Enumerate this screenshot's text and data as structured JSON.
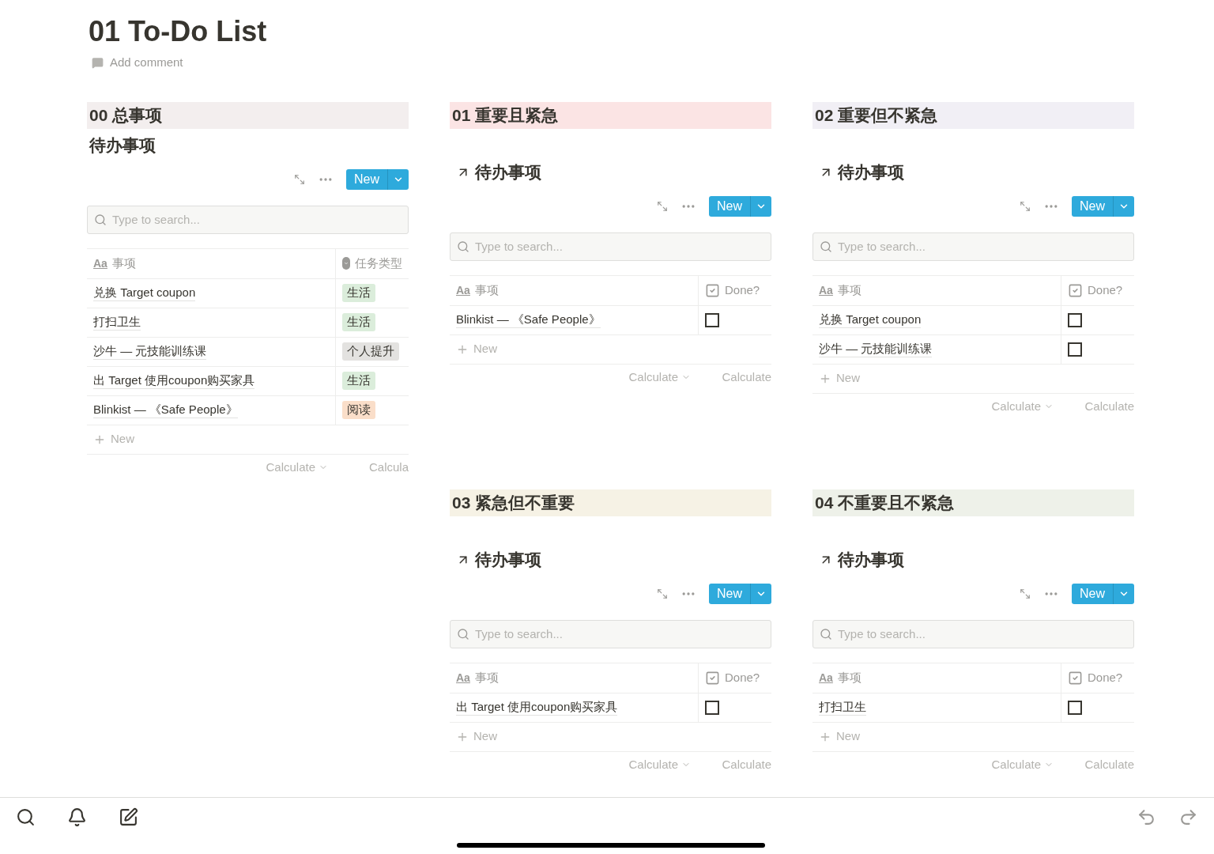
{
  "page": {
    "title": "01 To-Do List",
    "comment_action": "Add comment"
  },
  "sections": [
    {
      "title": "00 总事项",
      "color": "#f3eeee",
      "view": {
        "kind": "inline",
        "title": "待办事项",
        "new_button": "New",
        "search": {
          "placeholder": "Type to search..."
        },
        "columns": [
          {
            "kind": "title",
            "icon_text": "Aa",
            "label": "事项"
          },
          {
            "kind": "select",
            "label": "任务类型"
          }
        ],
        "rows": [
          {
            "title": "兑换 Target coupon",
            "tag": {
              "label": "生活",
              "color": "#dbeddb"
            }
          },
          {
            "title": "打扫卫生",
            "tag": {
              "label": "生活",
              "color": "#dbeddb"
            }
          },
          {
            "title": "沙牛 — 元技能训练课",
            "tag": {
              "label": "个人提升",
              "color": "#e3e2e0"
            }
          },
          {
            "title": "出 Target 使用coupon购买家具",
            "tag": {
              "label": "生活",
              "color": "#dbeddb"
            }
          },
          {
            "title": "Blinkist — 《Safe People》",
            "tag": {
              "label": "阅读",
              "color": "#fadec9"
            }
          }
        ],
        "add_row": "New",
        "footer": [
          "Calculate",
          "Calcula"
        ]
      }
    },
    {
      "title": "01 重要且紧急",
      "color": "#fbe4e4",
      "view": {
        "kind": "linked",
        "title": "待办事项",
        "new_button": "New",
        "search": {
          "placeholder": "Type to search..."
        },
        "columns": [
          {
            "kind": "title",
            "icon_text": "Aa",
            "label": "事项"
          },
          {
            "kind": "checkbox",
            "label": "Done?"
          }
        ],
        "rows": [
          {
            "title": "Blinkist — 《Safe People》",
            "checked": false
          }
        ],
        "add_row": "New",
        "footer": [
          "Calculate",
          "Calculate"
        ]
      }
    },
    {
      "title": "02 重要但不紧急",
      "color": "#f1eff5",
      "view": {
        "kind": "linked",
        "title": "待办事项",
        "new_button": "New",
        "search": {
          "placeholder": "Type to search..."
        },
        "columns": [
          {
            "kind": "title",
            "icon_text": "Aa",
            "label": "事项"
          },
          {
            "kind": "checkbox",
            "label": "Done?"
          }
        ],
        "rows": [
          {
            "title": "兑换 Target coupon",
            "checked": false
          },
          {
            "title": "沙牛 — 元技能训练课",
            "checked": false
          }
        ],
        "add_row": "New",
        "footer": [
          "Calculate",
          "Calculate"
        ]
      }
    },
    {
      "title": "03 紧急但不重要",
      "color": "#f6f2e5",
      "view": {
        "kind": "linked",
        "title": "待办事项",
        "new_button": "New",
        "search": {
          "placeholder": "Type to search..."
        },
        "columns": [
          {
            "kind": "title",
            "icon_text": "Aa",
            "label": "事项"
          },
          {
            "kind": "checkbox",
            "label": "Done?"
          }
        ],
        "rows": [
          {
            "title": "出 Target 使用coupon购买家具",
            "checked": false
          }
        ],
        "add_row": "New",
        "footer": [
          "Calculate",
          "Calculate"
        ]
      }
    },
    {
      "title": "04 不重要且不紧急",
      "color": "#eef1e9",
      "view": {
        "kind": "linked",
        "title": "待办事项",
        "new_button": "New",
        "search": {
          "placeholder": "Type to search..."
        },
        "columns": [
          {
            "kind": "title",
            "icon_text": "Aa",
            "label": "事项"
          },
          {
            "kind": "checkbox",
            "label": "Done?"
          }
        ],
        "rows": [
          {
            "title": "打扫卫生",
            "checked": false
          }
        ],
        "add_row": "New",
        "footer": [
          "Calculate",
          "Calculate"
        ]
      }
    }
  ]
}
